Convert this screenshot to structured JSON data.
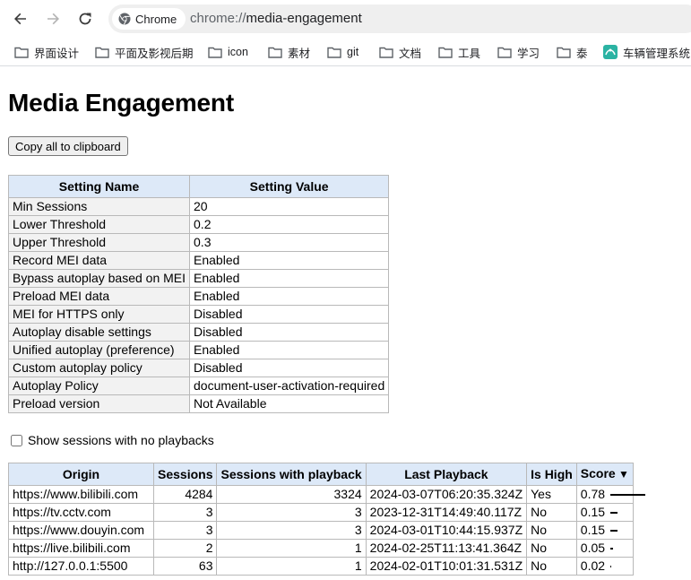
{
  "browser": {
    "chip_label": "Chrome",
    "url_scheme": "chrome://",
    "url_host": "media-engagement"
  },
  "bookmarks": [
    {
      "label": "界面设计",
      "icon": "folder-icon"
    },
    {
      "label": "平面及影视后期",
      "icon": "folder-icon"
    },
    {
      "label": "icon",
      "icon": "folder-icon"
    },
    {
      "label": "素材",
      "icon": "folder-icon"
    },
    {
      "label": "git",
      "icon": "folder-icon"
    },
    {
      "label": "文档",
      "icon": "folder-icon"
    },
    {
      "label": "工具",
      "icon": "folder-icon"
    },
    {
      "label": "学习",
      "icon": "folder-icon"
    },
    {
      "label": "泰",
      "icon": "folder-icon"
    },
    {
      "label": "车辆管理系统",
      "icon": "site-icon"
    }
  ],
  "page": {
    "title": "Media Engagement",
    "copy_button": "Copy all to clipboard",
    "show_no_playbacks_label": "Show sessions with no playbacks",
    "show_no_playbacks_checked": false
  },
  "settings": {
    "headers": [
      "Setting Name",
      "Setting Value"
    ],
    "rows": [
      [
        "Min Sessions",
        "20"
      ],
      [
        "Lower Threshold",
        "0.2"
      ],
      [
        "Upper Threshold",
        "0.3"
      ],
      [
        "Record MEI data",
        "Enabled"
      ],
      [
        "Bypass autoplay based on MEI",
        "Enabled"
      ],
      [
        "Preload MEI data",
        "Enabled"
      ],
      [
        "MEI for HTTPS only",
        "Disabled"
      ],
      [
        "Autoplay disable settings",
        "Disabled"
      ],
      [
        "Unified autoplay (preference)",
        "Enabled"
      ],
      [
        "Custom autoplay policy",
        "Disabled"
      ],
      [
        "Autoplay Policy",
        "document-user-activation-required"
      ],
      [
        "Preload version",
        "Not Available"
      ]
    ]
  },
  "sessions": {
    "headers": [
      "Origin",
      "Sessions",
      "Sessions with playback",
      "Last Playback",
      "Is High",
      "Score"
    ],
    "sorted_column": "Score",
    "rows": [
      {
        "origin": "https://www.bilibili.com",
        "sessions": "4284",
        "with_playback": "3324",
        "last_playback": "2024-03-07T06:20:35.324Z",
        "is_high": "Yes",
        "score": "0.78",
        "score_value": 0.78
      },
      {
        "origin": "https://tv.cctv.com",
        "sessions": "3",
        "with_playback": "3",
        "last_playback": "2023-12-31T14:49:40.117Z",
        "is_high": "No",
        "score": "0.15",
        "score_value": 0.15
      },
      {
        "origin": "https://www.douyin.com",
        "sessions": "3",
        "with_playback": "3",
        "last_playback": "2024-03-01T10:44:15.937Z",
        "is_high": "No",
        "score": "0.15",
        "score_value": 0.15
      },
      {
        "origin": "https://live.bilibili.com",
        "sessions": "2",
        "with_playback": "1",
        "last_playback": "2024-02-25T11:13:41.364Z",
        "is_high": "No",
        "score": "0.05",
        "score_value": 0.05
      },
      {
        "origin": "http://127.0.0.1:5500",
        "sessions": "63",
        "with_playback": "1",
        "last_playback": "2024-02-01T10:01:31.531Z",
        "is_high": "No",
        "score": "0.02",
        "score_value": 0.02
      }
    ]
  }
}
